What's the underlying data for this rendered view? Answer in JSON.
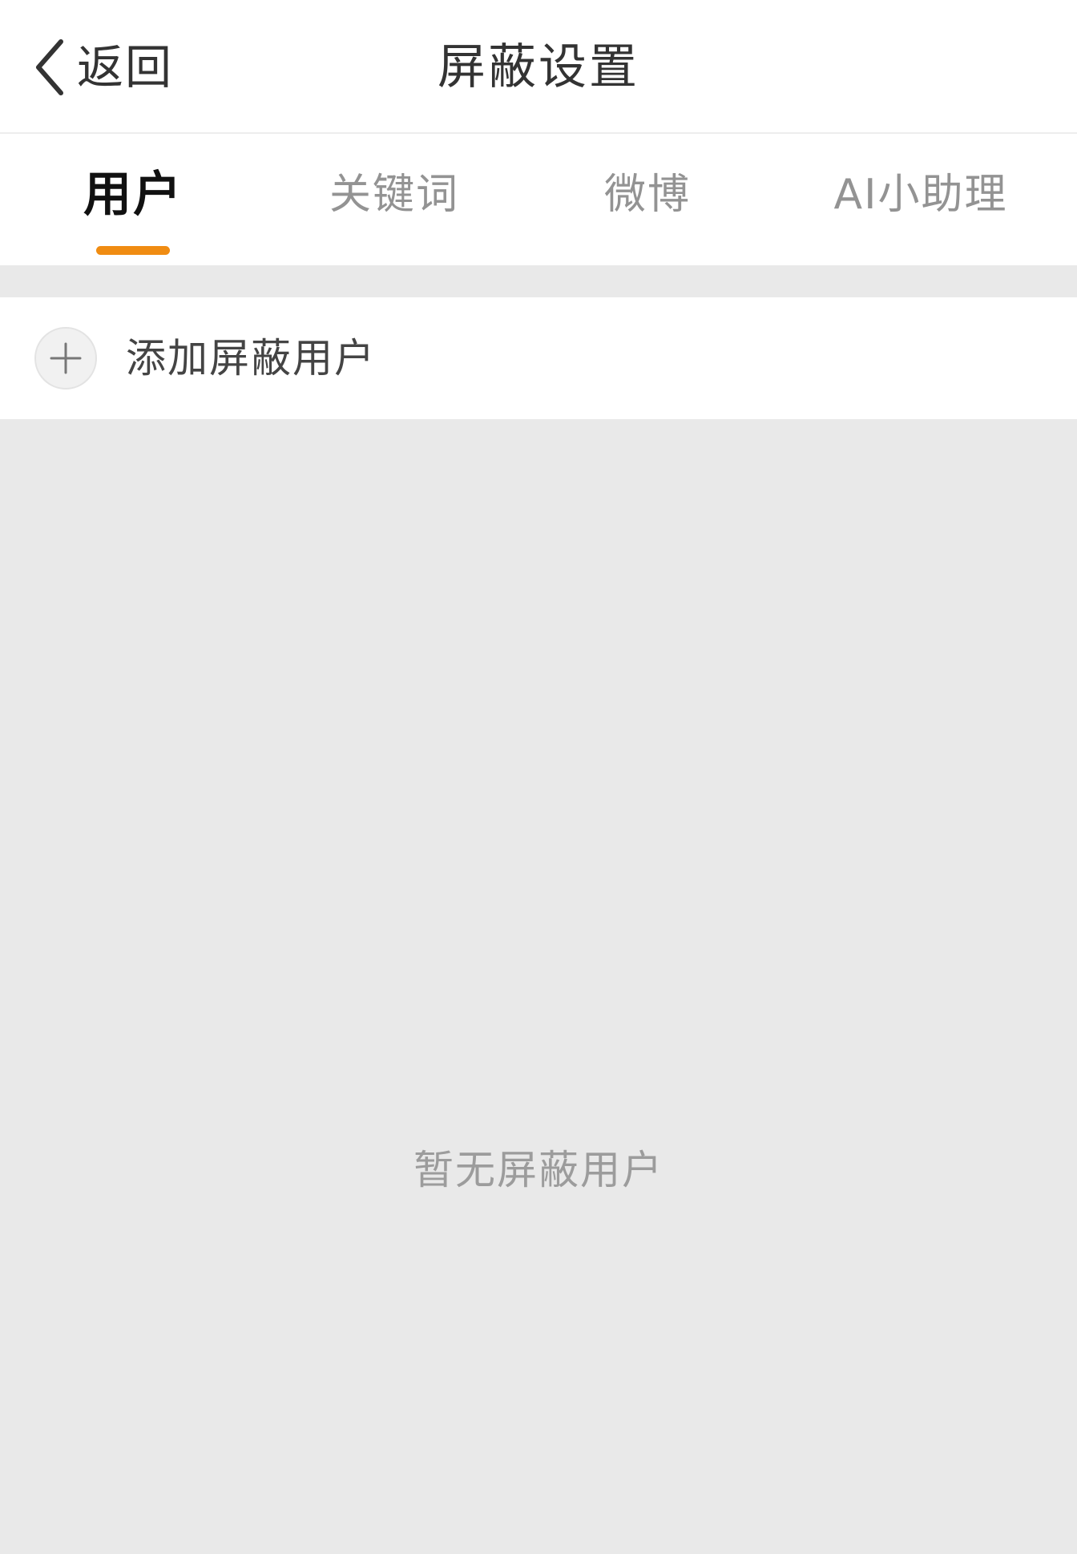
{
  "header": {
    "back_label": "返回",
    "title": "屏蔽设置"
  },
  "tabs": [
    {
      "label": "用户",
      "active": true
    },
    {
      "label": "关键词",
      "active": false
    },
    {
      "label": "微博",
      "active": false
    },
    {
      "label": "AI小助理",
      "active": false
    }
  ],
  "add_row": {
    "label": "添加屏蔽用户",
    "icon": "plus-icon"
  },
  "empty_state": {
    "text": "暂无屏蔽用户"
  },
  "colors": {
    "accent": "#f08c12",
    "background": "#e9e9e9",
    "surface": "#ffffff",
    "text_primary": "#333333",
    "text_muted": "#939393"
  }
}
